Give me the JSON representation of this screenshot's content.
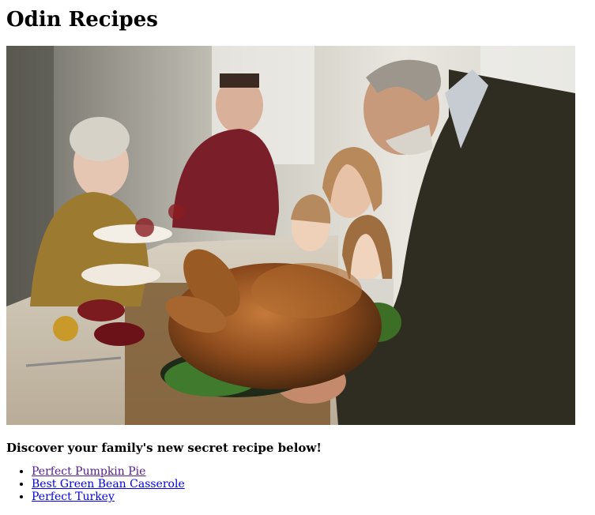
{
  "page": {
    "title": "Odin Recipes",
    "tagline": "Discover your family's new secret recipe below!"
  },
  "hero_image": {
    "icon": "photo-family-turkey-dinner"
  },
  "recipes": [
    {
      "label": "Perfect Pumpkin Pie",
      "visited": true
    },
    {
      "label": "Best Green Bean Casserole",
      "visited": false
    },
    {
      "label": "Perfect Turkey",
      "visited": false
    }
  ],
  "colors": {
    "link_visited": "#551a8b",
    "link_unvisited": "#0000ee"
  }
}
